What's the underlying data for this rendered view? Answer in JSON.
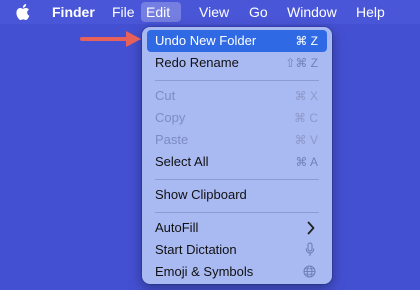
{
  "menubar": {
    "items": [
      {
        "label": "Finder"
      },
      {
        "label": "File"
      },
      {
        "label": "Edit"
      },
      {
        "label": "View"
      },
      {
        "label": "Go"
      },
      {
        "label": "Window"
      },
      {
        "label": "Help"
      }
    ]
  },
  "edit_menu": {
    "items": [
      {
        "label": "Undo New Folder",
        "shortcut": "⌘ Z"
      },
      {
        "label": "Redo Rename",
        "shortcut": "⇧⌘ Z"
      },
      {
        "label": "Cut",
        "shortcut": "⌘ X"
      },
      {
        "label": "Copy",
        "shortcut": "⌘ C"
      },
      {
        "label": "Paste",
        "shortcut": "⌘ V"
      },
      {
        "label": "Select All",
        "shortcut": "⌘ A"
      },
      {
        "label": "Show Clipboard"
      },
      {
        "label": "AutoFill"
      },
      {
        "label": "Start Dictation"
      },
      {
        "label": "Emoji & Symbols"
      }
    ]
  },
  "colors": {
    "desktop": "#4450d2",
    "menu_background": "#a9b9f2",
    "highlight": "#2f6ae4",
    "annotation_arrow": "#e8605a"
  }
}
